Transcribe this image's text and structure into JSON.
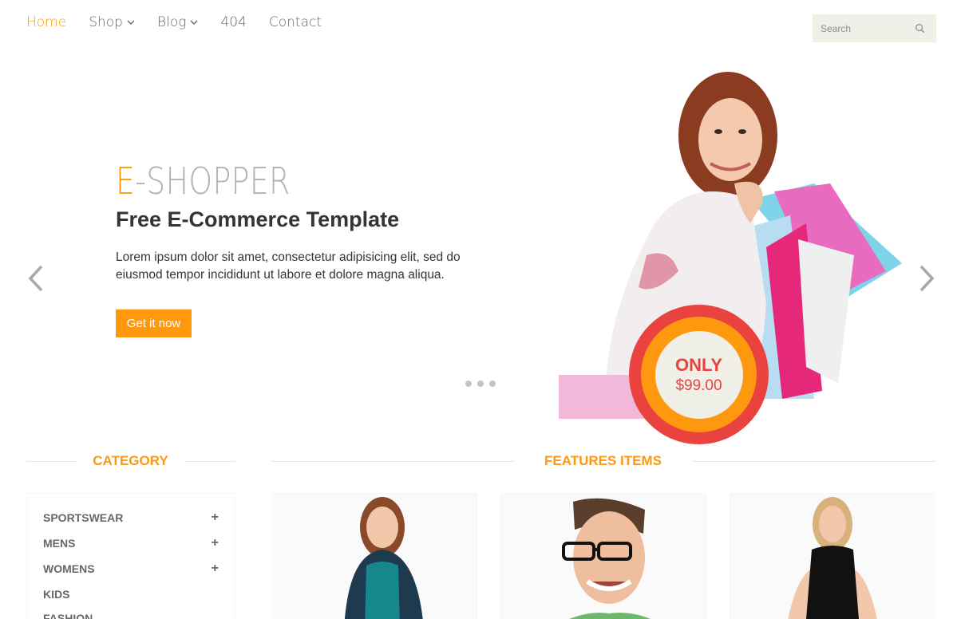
{
  "nav": {
    "items": [
      {
        "label": "Home",
        "active": true
      },
      {
        "label": "Shop",
        "dropdown": true
      },
      {
        "label": "Blog",
        "dropdown": true
      },
      {
        "label": "404"
      },
      {
        "label": "Contact"
      }
    ],
    "search_placeholder": "Search",
    "search_icon": "search-icon"
  },
  "slider": {
    "brand_accent": "E",
    "brand_rest": "-SHOPPER",
    "title": "Free E-Commerce Template",
    "text": "Lorem ipsum dolor sit amet, consectetur adipisicing elit, sed do eiusmod tempor incididunt ut labore et dolore magna aliqua.",
    "cta": "Get it now",
    "badge_top": "ONLY",
    "badge_price": "$99.00",
    "dots": 3,
    "prev_icon": "chevron-left-icon",
    "next_icon": "chevron-right-icon"
  },
  "category": {
    "heading": "CATEGORY",
    "items": [
      {
        "label": "SPORTSWEAR",
        "expandable": true
      },
      {
        "label": "MENS",
        "expandable": true
      },
      {
        "label": "WOMENS",
        "expandable": true
      },
      {
        "label": "KIDS",
        "expandable": false
      },
      {
        "label": "FASHION",
        "expandable": false
      }
    ]
  },
  "features": {
    "heading": "FEATURES ITEMS"
  },
  "colors": {
    "accent": "#FE980F",
    "text": "#696763",
    "dark": "#363432",
    "badge_red": "#E9423F",
    "panel_bg": "#F0F0E9"
  }
}
